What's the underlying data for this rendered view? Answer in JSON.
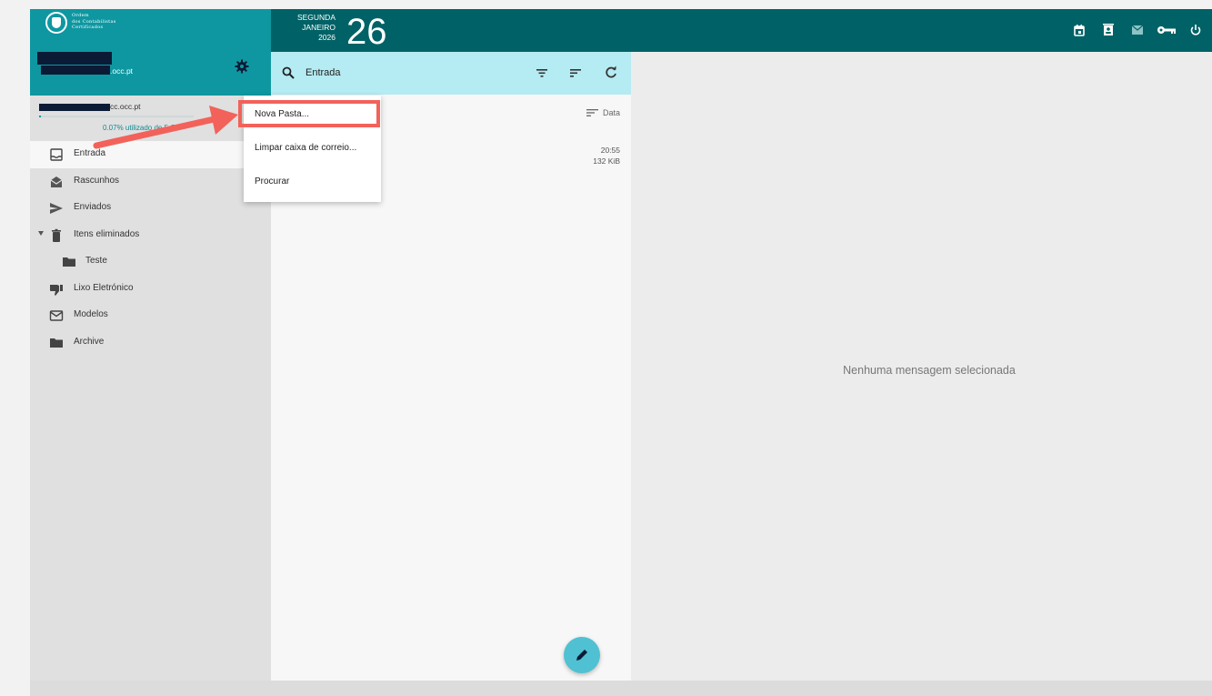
{
  "brand": {
    "logo_lines": [
      "Ordem",
      "dos Contabilistas",
      "Certificados"
    ]
  },
  "topbar": {
    "weekday": "SEGUNDA",
    "month": "JANEIRO",
    "year": "2026",
    "day": "26",
    "icons": [
      "calendar-icon",
      "contacts-icon",
      "mail-icon",
      "key-icon",
      "power-icon"
    ]
  },
  "account": {
    "domain_suffix": ".occ.pt",
    "quota_email_suffix": "cc.occ.pt",
    "quota_percent": 0.07,
    "quota_text": "0.07% utilizado de 5 GB"
  },
  "folders": [
    {
      "label": "Entrada",
      "icon": "inbox-icon",
      "active": true
    },
    {
      "label": "Rascunhos",
      "icon": "drafts-icon"
    },
    {
      "label": "Enviados",
      "icon": "send-icon"
    },
    {
      "label": "Itens eliminados",
      "icon": "trash-icon",
      "expanded": true
    },
    {
      "label": "Teste",
      "icon": "folder-icon",
      "sub": true
    },
    {
      "label": "Lixo Eletrónico",
      "icon": "thumbs-down-icon"
    },
    {
      "label": "Modelos",
      "icon": "template-icon"
    },
    {
      "label": "Archive",
      "icon": "folder-icon"
    }
  ],
  "message_list": {
    "search_label": "Entrada",
    "sort_label": "Data",
    "messages": [
      {
        "time": "20:55",
        "size": "132 KiB"
      }
    ]
  },
  "reading_pane": {
    "empty_text": "Nenhuma mensagem selecionada"
  },
  "context_menu": {
    "items": [
      "Nova Pasta...",
      "Limpar caixa de correio...",
      "Procurar"
    ]
  },
  "annotation_color": "#f2625a"
}
